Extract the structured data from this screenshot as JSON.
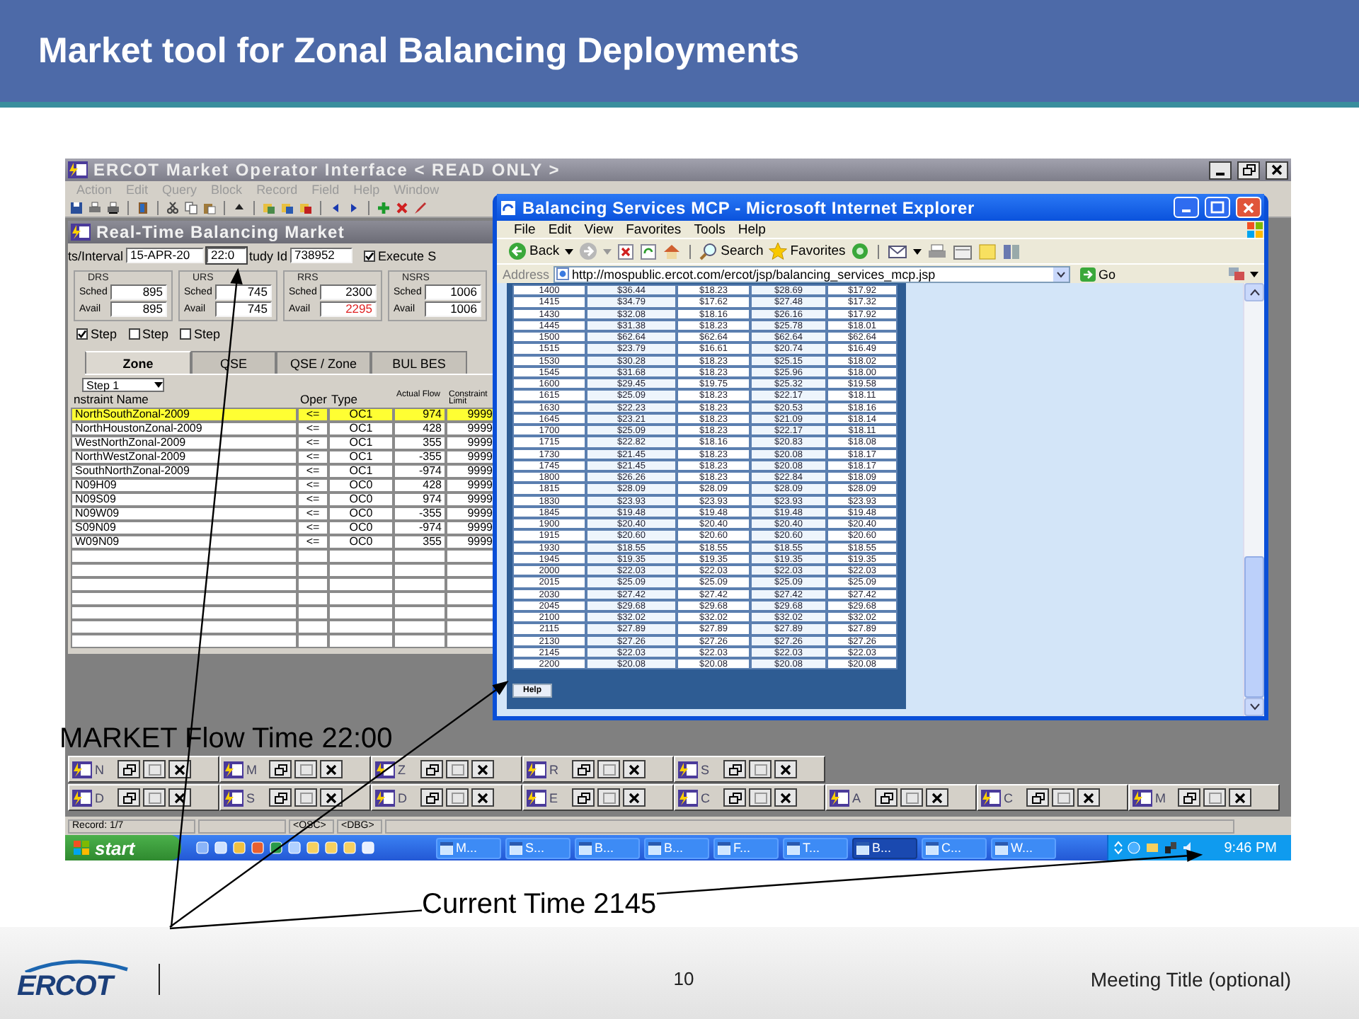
{
  "slide_title": "Market tool for Zonal Balancing Deployments",
  "app": {
    "title": "ERCOT Market Operator Interface < READ ONLY >",
    "menu": [
      "Action",
      "Edit",
      "Query",
      "Block",
      "Record",
      "Field",
      "Help",
      "Window"
    ],
    "child": {
      "title": "Real-Time Balancing Market",
      "interval_label": "ts/Interval",
      "interval_date": "15-APR-20",
      "interval_time": "22:0",
      "study_label": "tudy Id",
      "study_id": "738952",
      "execute": {
        "label": "Execute S",
        "checked": true
      },
      "groups": [
        {
          "name": "DRS",
          "sched_label": "Sched",
          "sched": "895",
          "avail_label": "Avail",
          "avail": "895",
          "alert": false
        },
        {
          "name": "URS",
          "sched_label": "Sched",
          "sched": "745",
          "avail_label": "Avail",
          "avail": "745",
          "alert": false
        },
        {
          "name": "RRS",
          "sched_label": "Sched",
          "sched": "2300",
          "avail_label": "Avail",
          "avail": "2295",
          "alert": true
        },
        {
          "name": "NSRS",
          "sched_label": "Sched",
          "sched": "1006",
          "avail_label": "Avail",
          "avail": "1006",
          "alert": false
        }
      ],
      "steps": [
        {
          "label": "Step",
          "checked": true
        },
        {
          "label": "Step",
          "checked": false
        },
        {
          "label": "Step",
          "checked": false
        }
      ],
      "tabs": [
        {
          "label": "Zone",
          "selected": true
        },
        {
          "label": "QSE",
          "selected": false
        },
        {
          "label": "QSE / Zone",
          "selected": false
        },
        {
          "label": "BUL BES",
          "selected": false
        }
      ],
      "step_select": "Step 1",
      "columns": [
        "nstraint Name",
        "Oper",
        "Type",
        "Actual Flow",
        "Constraint Limit"
      ],
      "rows": [
        {
          "cells": [
            "NorthSouthZonal-2009",
            "<=",
            "OC1",
            "974",
            "9999"
          ],
          "selected": true
        },
        {
          "cells": [
            "NorthHoustonZonal-2009",
            "<=",
            "OC1",
            "428",
            "9999"
          ],
          "selected": false
        },
        {
          "cells": [
            "WestNorthZonal-2009",
            "<=",
            "OC1",
            "355",
            "9999"
          ],
          "selected": false
        },
        {
          "cells": [
            "NorthWestZonal-2009",
            "<=",
            "OC1",
            "-355",
            "9999"
          ],
          "selected": false
        },
        {
          "cells": [
            "SouthNorthZonal-2009",
            "<=",
            "OC1",
            "-974",
            "9999"
          ],
          "selected": false
        },
        {
          "cells": [
            "N09H09",
            "<=",
            "OC0",
            "428",
            "9999"
          ],
          "selected": false
        },
        {
          "cells": [
            "N09S09",
            "<=",
            "OC0",
            "974",
            "9999"
          ],
          "selected": false
        },
        {
          "cells": [
            "N09W09",
            "<=",
            "OC0",
            "-355",
            "9999"
          ],
          "selected": false
        },
        {
          "cells": [
            "S09N09",
            "<=",
            "OC0",
            "-974",
            "9999"
          ],
          "selected": false
        },
        {
          "cells": [
            "W09N09",
            "<=",
            "OC0",
            "355",
            "9999"
          ],
          "selected": false
        }
      ]
    },
    "minimized": [
      {
        "items": [
          {
            "letter": "N"
          },
          {
            "letter": "M"
          },
          {
            "letter": "Z"
          },
          {
            "letter": "R"
          },
          {
            "letter": "S"
          }
        ]
      },
      {
        "items": [
          {
            "letter": "D"
          },
          {
            "letter": "S"
          },
          {
            "letter": "D"
          },
          {
            "letter": "E"
          },
          {
            "letter": "C"
          },
          {
            "letter": "A"
          },
          {
            "letter": "C"
          },
          {
            "letter": "M"
          }
        ]
      }
    ],
    "status_bar": [
      "Record: 1/7",
      "<OSC>",
      "<DBG>"
    ]
  },
  "taskbar": {
    "start": "start",
    "tasks": [
      {
        "label": "M...",
        "selected": false
      },
      {
        "label": "S...",
        "selected": false
      },
      {
        "label": "B...",
        "selected": false
      },
      {
        "label": "B...",
        "selected": false
      },
      {
        "label": "F...",
        "selected": false
      },
      {
        "label": "T...",
        "selected": false
      },
      {
        "label": "B...",
        "selected": true
      },
      {
        "label": "C...",
        "selected": false
      },
      {
        "label": "W...",
        "selected": false
      }
    ],
    "clock": "9:46 PM"
  },
  "browser": {
    "title": "Balancing Services MCP - Microsoft Internet Explorer",
    "menu": [
      "File",
      "Edit",
      "View",
      "Favorites",
      "Tools",
      "Help"
    ],
    "toolbar": {
      "back": "Back",
      "search": "Search",
      "favorites": "Favorites"
    },
    "address_label": "Address",
    "url": "http://mospublic.ercot.com/ercot/jsp/balancing_services_mcp.jsp",
    "go": "Go",
    "rows": [
      [
        "1400",
        "$36.44",
        "$18.23",
        "$28.69",
        "$17.92"
      ],
      [
        "1415",
        "$34.79",
        "$17.62",
        "$27.48",
        "$17.32"
      ],
      [
        "1430",
        "$32.08",
        "$18.16",
        "$26.16",
        "$17.92"
      ],
      [
        "1445",
        "$31.38",
        "$18.23",
        "$25.78",
        "$18.01"
      ],
      [
        "1500",
        "$62.64",
        "$62.64",
        "$62.64",
        "$62.64"
      ],
      [
        "1515",
        "$23.79",
        "$16.61",
        "$20.74",
        "$16.49"
      ],
      [
        "1530",
        "$30.28",
        "$18.23",
        "$25.15",
        "$18.02"
      ],
      [
        "1545",
        "$31.68",
        "$18.23",
        "$25.96",
        "$18.00"
      ],
      [
        "1600",
        "$29.45",
        "$19.75",
        "$25.32",
        "$19.58"
      ],
      [
        "1615",
        "$25.09",
        "$18.23",
        "$22.17",
        "$18.11"
      ],
      [
        "1630",
        "$22.23",
        "$18.23",
        "$20.53",
        "$18.16"
      ],
      [
        "1645",
        "$23.21",
        "$18.23",
        "$21.09",
        "$18.14"
      ],
      [
        "1700",
        "$25.09",
        "$18.23",
        "$22.17",
        "$18.11"
      ],
      [
        "1715",
        "$22.82",
        "$18.16",
        "$20.83",
        "$18.08"
      ],
      [
        "1730",
        "$21.45",
        "$18.23",
        "$20.08",
        "$18.17"
      ],
      [
        "1745",
        "$21.45",
        "$18.23",
        "$20.08",
        "$18.17"
      ],
      [
        "1800",
        "$26.26",
        "$18.23",
        "$22.84",
        "$18.09"
      ],
      [
        "1815",
        "$28.09",
        "$28.09",
        "$28.09",
        "$28.09"
      ],
      [
        "1830",
        "$23.93",
        "$23.93",
        "$23.93",
        "$23.93"
      ],
      [
        "1845",
        "$19.48",
        "$19.48",
        "$19.48",
        "$19.48"
      ],
      [
        "1900",
        "$20.40",
        "$20.40",
        "$20.40",
        "$20.40"
      ],
      [
        "1915",
        "$20.60",
        "$20.60",
        "$20.60",
        "$20.60"
      ],
      [
        "1930",
        "$18.55",
        "$18.55",
        "$18.55",
        "$18.55"
      ],
      [
        "1945",
        "$19.35",
        "$19.35",
        "$19.35",
        "$19.35"
      ],
      [
        "2000",
        "$22.03",
        "$22.03",
        "$22.03",
        "$22.03"
      ],
      [
        "2015",
        "$25.09",
        "$25.09",
        "$25.09",
        "$25.09"
      ],
      [
        "2030",
        "$27.42",
        "$27.42",
        "$27.42",
        "$27.42"
      ],
      [
        "2045",
        "$29.68",
        "$29.68",
        "$29.68",
        "$29.68"
      ],
      [
        "2100",
        "$32.02",
        "$32.02",
        "$32.02",
        "$32.02"
      ],
      [
        "2115",
        "$27.89",
        "$27.89",
        "$27.89",
        "$27.89"
      ],
      [
        "2130",
        "$27.26",
        "$27.26",
        "$27.26",
        "$27.26"
      ],
      [
        "2145",
        "$22.03",
        "$22.03",
        "$22.03",
        "$22.03"
      ],
      [
        "2200",
        "$20.08",
        "$20.08",
        "$20.08",
        "$20.08"
      ]
    ],
    "help": "Help"
  },
  "annotations": [
    {
      "text": "MARKET Flow Time 22:00"
    },
    {
      "text": "Current Time 2145"
    }
  ],
  "footer": {
    "logo": "ERCOT",
    "page": "10",
    "meeting": "Meeting Title (optional)"
  }
}
